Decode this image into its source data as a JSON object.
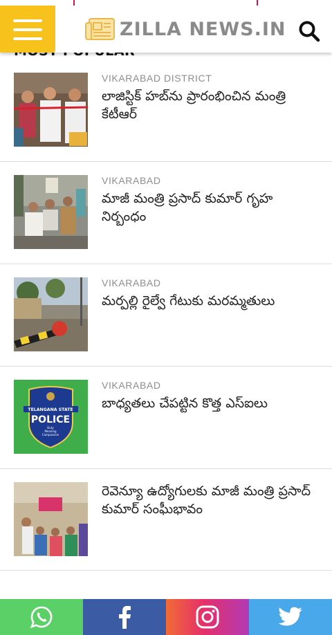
{
  "header": {
    "logo_text": "ZILLA NEWS.IN",
    "menu_icon": "hamburger-menu-icon",
    "search_icon": "search-icon",
    "accent_color": "#f7c21b"
  },
  "section": {
    "title": "MOST POPULAR"
  },
  "articles": [
    {
      "category": "VIKARABAD DISTRICT",
      "title": "లాజిస్టిక్ హబ్‌ను ప్రారంభించిన మంత్రి కేటీఆర్"
    },
    {
      "category": "VIKARABAD",
      "title": "మాజీ మంత్రి ప్రసాద్ కుమార్ గృహ నిర్బంధం"
    },
    {
      "category": "VIKARABAD",
      "title": "మర్పల్లి రైల్వే గేటుకు మరమ్మతులు"
    },
    {
      "category": "VIKARABAD",
      "title": "బాధ్యతలు చేపట్టిన కొత్త ఎస్ఐలు",
      "badge_lines": [
        "TELANGANA STATE",
        "POLICE",
        "Duty",
        "Meaning",
        "Compassion"
      ]
    },
    {
      "category": "",
      "title": "రెవెన్యూ ఉద్యోగులకు మాజీ మంత్రి ప్రసాద్ కుమార్ సంఘీభావం"
    }
  ],
  "footer": {
    "links": [
      {
        "icon": "whatsapp-icon",
        "color": "#5bd066"
      },
      {
        "icon": "facebook-icon",
        "color": "#3b5ba5"
      },
      {
        "icon": "instagram-icon",
        "color": "#e5306a"
      },
      {
        "icon": "twitter-icon",
        "color": "#48a8e9"
      }
    ]
  }
}
